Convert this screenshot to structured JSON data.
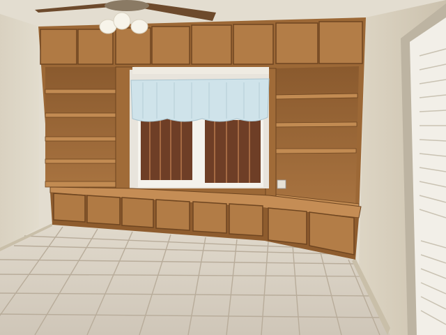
{
  "scene": {
    "description_visible_text": "",
    "colors": {
      "wall": "#ddd6c6",
      "wall_shadow": "#cfc6b3",
      "ceiling": "#e6e0d2",
      "wood": "#a8733f",
      "wood_dark": "#7a4f26",
      "wood_light": "#c08850",
      "floor_tile": "#d7cfc2",
      "grout": "#b9ad9c",
      "curtain": "#cfe3ea",
      "shutter": "#6e3e26",
      "window_light": "#f4f2ec",
      "door": "#f2efe8"
    },
    "objects": {
      "ceiling_fan": "ceiling-fan",
      "built_in_bookcase": "built-in-bookcase",
      "window": "window",
      "door": "louvered-door",
      "floor": "tile-floor"
    }
  }
}
